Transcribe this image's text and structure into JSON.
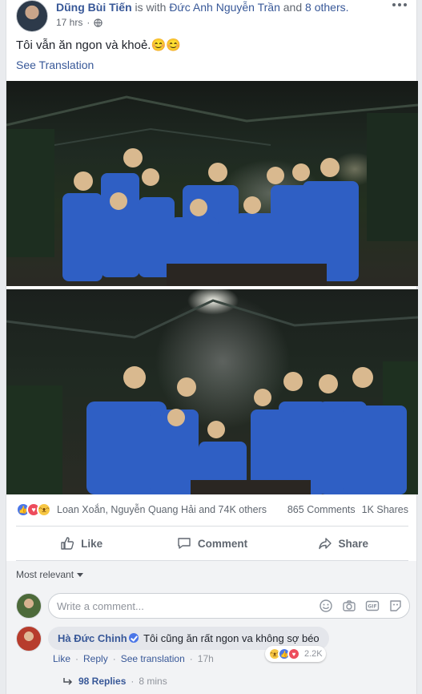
{
  "post": {
    "author": "Dũng Bùi Tiến",
    "with_text": "is with",
    "tagged": "Đức Anh Nguyễn Trần",
    "and_text": "and",
    "others": "8 others.",
    "time": "17 hrs",
    "privacy_dot": "·",
    "text": "Tôi vẫn ăn ngon và khoẻ.😊😊",
    "see_translation": "See Translation"
  },
  "reactions": {
    "names": "Loan Xoắn, Nguyễn Quang Hải and 74K others",
    "comments": "865 Comments",
    "shares": "1K Shares"
  },
  "actions": {
    "like": "Like",
    "comment": "Comment",
    "share": "Share"
  },
  "comments_section": {
    "sort_label": "Most relevant",
    "input_placeholder": "Write a comment...",
    "comment": {
      "author": "Hà Đức Chinh",
      "text": "Tôi cũng ăn rất ngon va không sợ béo",
      "reaction_count": "2.2K",
      "like": "Like",
      "reply": "Reply",
      "see_translation": "See translation",
      "time": "17h",
      "sep": "·"
    },
    "replies": {
      "count": "98 Replies",
      "sep": "·",
      "time": "8 mins"
    }
  },
  "colors": {
    "link": "#385898",
    "meta": "#616770",
    "like_reaction": "#4a76e8",
    "love_reaction": "#ed4c5c",
    "haha_reaction": "#f7c744",
    "shirt_pattern": "#2f5fc4"
  }
}
